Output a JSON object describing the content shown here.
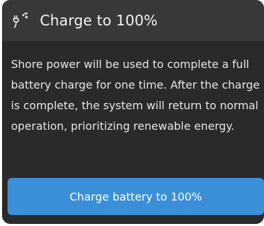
{
  "dialog": {
    "icon": "charge-plug-icon",
    "title": "Charge to 100%",
    "description": "Shore power will be used to complete a full battery charge for one time. After the charge is complete, the system will return to normal operation, prioritizing renewable energy.",
    "button_label": "Charge battery to 100%"
  },
  "colors": {
    "card_bg": "#2a2a2a",
    "header_bg": "#383838",
    "accent": "#3a8fd8",
    "text": "#f2f2f2"
  }
}
